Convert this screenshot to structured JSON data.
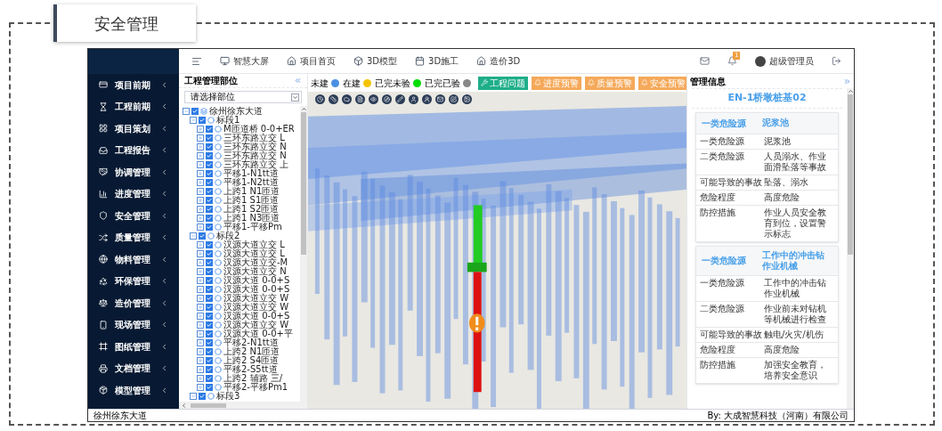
{
  "page_title": "安全管理",
  "top_nav": [
    {
      "label": "智慧大屏"
    },
    {
      "label": "项目首页"
    },
    {
      "label": "3D模型"
    },
    {
      "label": "3D施工"
    },
    {
      "label": "造价3D"
    }
  ],
  "notifications": {
    "count": "1"
  },
  "user": {
    "name": "超级管理员"
  },
  "sidebar": {
    "items": [
      {
        "label": "项目前期"
      },
      {
        "label": "工程前期"
      },
      {
        "label": "项目策划"
      },
      {
        "label": "工程报告"
      },
      {
        "label": "协调管理"
      },
      {
        "label": "进度管理"
      },
      {
        "label": "安全管理"
      },
      {
        "label": "质量管理"
      },
      {
        "label": "物料管理"
      },
      {
        "label": "环保管理"
      },
      {
        "label": "造价管理"
      },
      {
        "label": "现场管理"
      },
      {
        "label": "图纸管理"
      },
      {
        "label": "文档管理"
      },
      {
        "label": "模型管理"
      }
    ]
  },
  "tree_panel": {
    "title": "工程管理部位",
    "select": {
      "value": "请选择部位"
    },
    "tree": [
      {
        "label": "徐州徐东大道",
        "checked": true,
        "expanded": true,
        "children": [
          {
            "label": "标段1",
            "checked": true,
            "expanded": true,
            "children": [
              {
                "label": "M匝道桥 0-0+ER",
                "checked": true,
                "expanded": false
              },
              {
                "label": "三环东路立交 L",
                "checked": true,
                "expanded": false
              },
              {
                "label": "三环东路立交 N",
                "checked": true,
                "expanded": false
              },
              {
                "label": "三环东路立交 N",
                "checked": true,
                "expanded": false
              },
              {
                "label": "三环东路立交 上",
                "checked": true,
                "expanded": false
              },
              {
                "label": "平移1-N1tt道",
                "checked": true,
                "expanded": false
              },
              {
                "label": "平移1-N2tt道",
                "checked": true,
                "expanded": false
              },
              {
                "label": "上跨1 N1匝道",
                "checked": true,
                "expanded": false
              },
              {
                "label": "上跨1 S1匝道",
                "checked": true,
                "expanded": false
              },
              {
                "label": "上跨1 S2匝道",
                "checked": true,
                "expanded": false
              },
              {
                "label": "上跨1 N3匝道",
                "checked": true,
                "expanded": false
              },
              {
                "label": "平移1-平移Pm",
                "checked": true,
                "expanded": false
              }
            ]
          },
          {
            "label": "标段2",
            "checked": true,
            "expanded": true,
            "children": [
              {
                "label": "汉源大道立交 L",
                "checked": true,
                "expanded": false
              },
              {
                "label": "汉源大道立交 L",
                "checked": true,
                "expanded": false
              },
              {
                "label": "汉源大道立交-M",
                "checked": true,
                "expanded": false
              },
              {
                "label": "汉源大道立交 N",
                "checked": true,
                "expanded": false
              },
              {
                "label": "汉源大道 0-0+S",
                "checked": true,
                "expanded": false
              },
              {
                "label": "汉源大道 0-0+S",
                "checked": true,
                "expanded": false
              },
              {
                "label": "汉源大道立交 W",
                "checked": true,
                "expanded": false
              },
              {
                "label": "汉源大道立交 W",
                "checked": true,
                "expanded": false
              },
              {
                "label": "汉源大道 0-0+S",
                "checked": true,
                "expanded": false
              },
              {
                "label": "汉源大道立交 W",
                "checked": true,
                "expanded": false
              },
              {
                "label": "汉源大道 0-0+平",
                "checked": true,
                "expanded": false
              },
              {
                "label": "平移2-N1tt道",
                "checked": true,
                "expanded": false
              },
              {
                "label": "上跨2 N1匝道",
                "checked": true,
                "expanded": false
              },
              {
                "label": "上跨2 S4匝道",
                "checked": true,
                "expanded": false
              },
              {
                "label": "平移2-S5tt道",
                "checked": true,
                "expanded": false
              },
              {
                "label": "上跨2 辅路 三/",
                "checked": true,
                "expanded": false
              },
              {
                "label": "平移2-平移Pm1",
                "checked": true,
                "expanded": false
              }
            ]
          },
          {
            "label": "标段3",
            "checked": true,
            "expanded": true
          }
        ]
      }
    ]
  },
  "legend": [
    {
      "label": "未建",
      "color": "#4a90e2"
    },
    {
      "label": "在建",
      "color": "#f5c400"
    },
    {
      "label": "已完未验",
      "color": "#00dd00"
    },
    {
      "label": "已完已验",
      "color": "#888888"
    }
  ],
  "alert_buttons": [
    {
      "label": "工程问题",
      "kind": "issue"
    },
    {
      "label": "进度预警",
      "kind": "warning"
    },
    {
      "label": "质量预警",
      "kind": "warning"
    },
    {
      "label": "安全预警",
      "kind": "warning"
    }
  ],
  "info_panel": {
    "title": "管理信息",
    "heading": "EN-1桥墩桩基02",
    "cards": [
      {
        "header": [
          "一类危险源",
          "泥浆池"
        ],
        "rows": [
          [
            "一类危险源",
            "泥浆池"
          ],
          [
            "二类危险源",
            "人员溺水、作业面滑坠落等事故"
          ],
          [
            "可能导致的事故",
            "坠落、溺水"
          ],
          [
            "危险程度",
            "高度危险"
          ],
          [
            "防控措施",
            "作业人员安全教育到位，设置警示标志"
          ]
        ]
      },
      {
        "header": [
          "一类危险源",
          "工作中的冲击钻作业机械"
        ],
        "rows": [
          [
            "一类危险源",
            "工作中的冲击钻作业机械"
          ],
          [
            "二类危险源",
            "作业前未对钻机等机械进行检查"
          ],
          [
            "可能导致的事故",
            "触电/火灾/机伤"
          ],
          [
            "危险程度",
            "高度危险"
          ],
          [
            "防控措施",
            "加强安全教育，培养安全意识"
          ]
        ]
      }
    ]
  },
  "footer": {
    "project": "徐州徐东大道",
    "copyright": "By: 大成智慧科技（河南）有限公司"
  }
}
